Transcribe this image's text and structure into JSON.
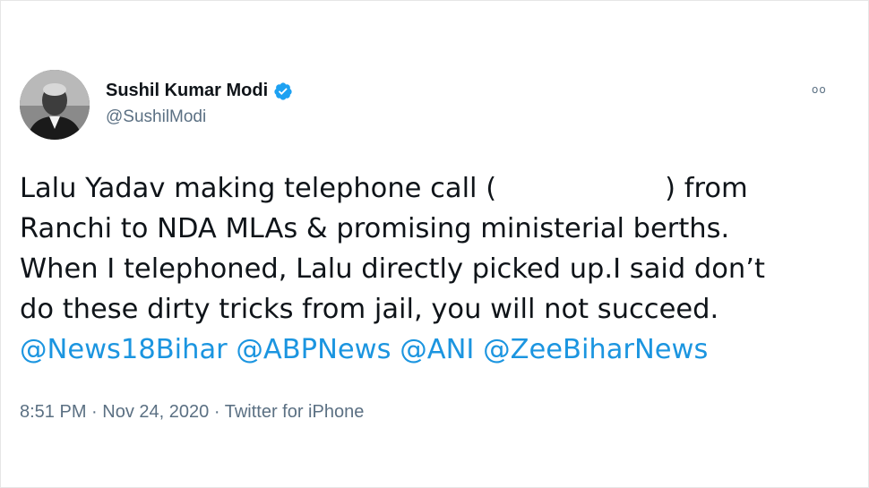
{
  "author": {
    "display_name": "Sushil Kumar Modi",
    "handle": "@SushilModi",
    "verified": true,
    "verified_icon": "verified-badge-icon",
    "avatar_icon": "profile-photo"
  },
  "more_menu": {
    "icon": "more-options-icon",
    "glyph": "oo"
  },
  "tweet": {
    "line1_a": "Lalu Yadav making telephone call (",
    "line1_b": ") from",
    "line2": "Ranchi to NDA MLAs & promising ministerial berths.",
    "line3": "When I telephoned, Lalu directly picked up.I said don’t",
    "line4": "do these dirty tricks from jail, you will not succeed.",
    "mentions": [
      "@News18Bihar",
      "@ABPNews",
      "@ANI",
      "@ZeeBiharNews"
    ]
  },
  "meta": {
    "time": "8:51 PM",
    "sep1": "·",
    "date": "Nov 24, 2020",
    "sep2": "·",
    "source": "Twitter for iPhone"
  },
  "colors": {
    "text": "#0f1419",
    "secondary": "#5b7083",
    "link": "#1b95e0",
    "verified": "#1da1f2"
  }
}
